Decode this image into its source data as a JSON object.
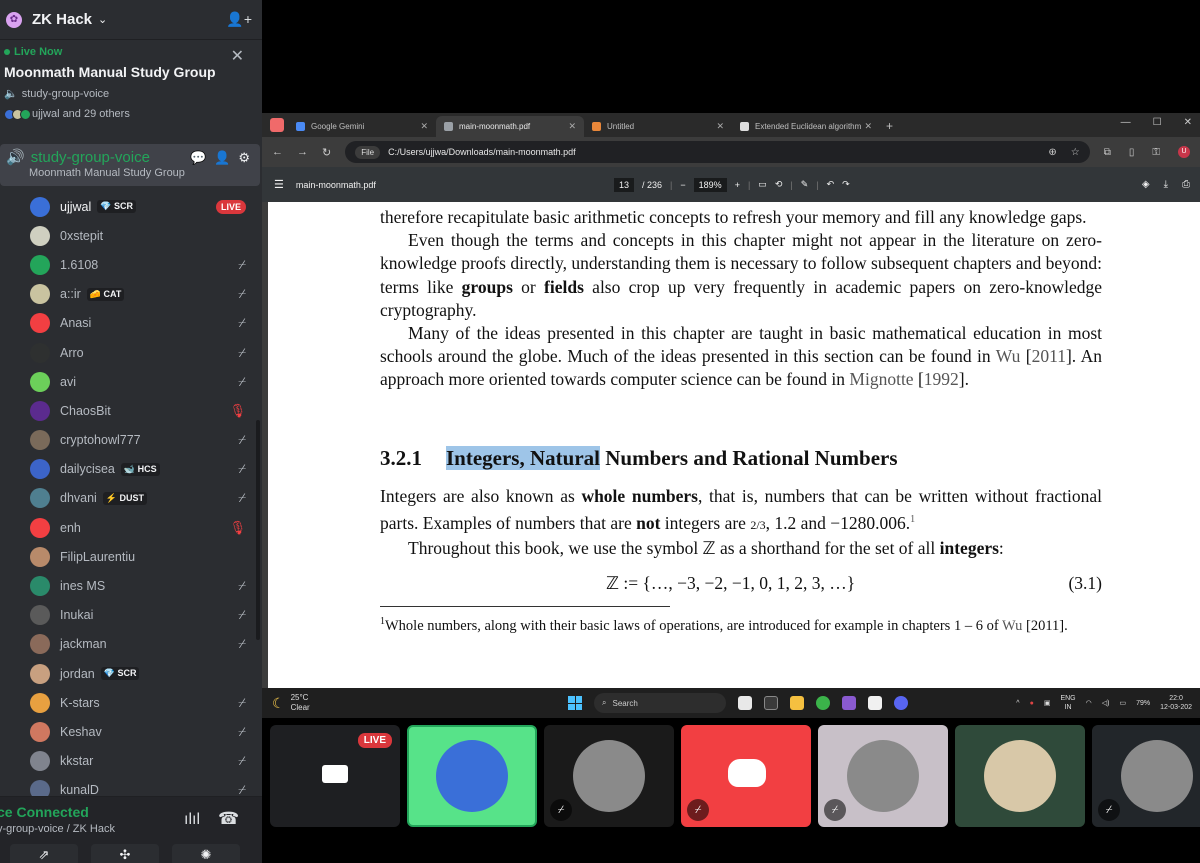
{
  "server": {
    "name": "ZK Hack"
  },
  "event": {
    "live_label": "Live Now",
    "title": "Moonmath Manual Study Group",
    "channel": "study-group-voice",
    "attendees": "ujjwal and 29 others"
  },
  "voice_channel": {
    "name": "study-group-voice",
    "subtitle": "Moonmath Manual Study Group"
  },
  "members": [
    {
      "name": "ujjwal",
      "tag": "SCR",
      "tag_icon": "💎",
      "status": "live",
      "color": "#3a6fd8"
    },
    {
      "name": "0xstepit",
      "tag": "",
      "status": "",
      "color": "#cfcfc0"
    },
    {
      "name": "1.6108",
      "tag": "",
      "status": "muted",
      "color": "#23a55a"
    },
    {
      "name": "a::ir",
      "tag": "CAT",
      "tag_icon": "🧀",
      "status": "muted",
      "color": "#c9c3a0"
    },
    {
      "name": "Anasi",
      "tag": "",
      "status": "muted",
      "color": "#f23f42"
    },
    {
      "name": "Arro",
      "tag": "",
      "status": "muted",
      "color": "#2e3030"
    },
    {
      "name": "avi",
      "tag": "",
      "status": "muted",
      "color": "#6ccf5a"
    },
    {
      "name": "ChaosBit",
      "tag": "",
      "status": "speaking",
      "color": "#5b2b8e"
    },
    {
      "name": "cryptohowl777",
      "tag": "",
      "status": "muted",
      "color": "#7a6a5a"
    },
    {
      "name": "dailycisea",
      "tag": "HCS",
      "tag_icon": "🐋",
      "status": "muted",
      "color": "#3c64c8"
    },
    {
      "name": "dhvani",
      "tag": "DUST",
      "tag_icon": "⚡",
      "status": "muted",
      "color": "#4f7f90"
    },
    {
      "name": "enh",
      "tag": "",
      "status": "speaking",
      "color": "#f23f42"
    },
    {
      "name": "FilipLaurentiu",
      "tag": "",
      "status": "",
      "color": "#b88a6a"
    },
    {
      "name": "ines MS",
      "tag": "",
      "status": "muted",
      "color": "#2a8a6a"
    },
    {
      "name": "Inukai",
      "tag": "",
      "status": "muted",
      "color": "#5a5a5a"
    },
    {
      "name": "jackman",
      "tag": "",
      "status": "muted",
      "color": "#8a6a5a"
    },
    {
      "name": "jordan",
      "tag": "SCR",
      "tag_icon": "💎",
      "status": "",
      "color": "#c8a080"
    },
    {
      "name": "K-stars",
      "tag": "",
      "status": "muted",
      "color": "#e8a040"
    },
    {
      "name": "Keshav",
      "tag": "",
      "status": "muted",
      "color": "#d07860"
    },
    {
      "name": "kkstar",
      "tag": "",
      "status": "muted",
      "color": "#80848e"
    },
    {
      "name": "kunalD",
      "tag": "",
      "status": "muted",
      "color": "#5a6a8a"
    }
  ],
  "voice_connected": {
    "title": "ce Connected",
    "subtitle": "y-group-voice / ZK Hack"
  },
  "browser": {
    "tabs": [
      {
        "label": "Google Gemini",
        "color": "#4a8af4",
        "active": false
      },
      {
        "label": "main-moonmath.pdf",
        "color": "#9aa0a6",
        "active": true
      },
      {
        "label": "Untitled",
        "color": "#e8873a",
        "active": false
      },
      {
        "label": "Extended Euclidean algorithm",
        "color": "#dddddd",
        "active": false
      }
    ],
    "url_chip": "File",
    "url": "C:/Users/ujjwa/Downloads/main-moonmath.pdf",
    "profile_letter": "U"
  },
  "pdf": {
    "filename": "main-moonmath.pdf",
    "page_current": "13",
    "page_total": "/ 236",
    "zoom": "189%"
  },
  "document": {
    "line0": "therefore recapitulate basic arithmetic concepts to refresh your memory and fill any knowledge gaps.",
    "p1_a": "Even though the terms and concepts in this chapter might not appear in the literature on zero-knowledge proofs directly, understanding them is necessary to follow subsequent chapters and beyond: terms like ",
    "p1_b": "groups",
    "p1_c": " or ",
    "p1_d": "fields",
    "p1_e": " also crop up very frequently in academic papers on zero-knowledge cryptography.",
    "p2_a": "Many of the ideas presented in this chapter are taught in basic mathematical education in most schools around the globe. Much of the ideas presented in this section can be found in ",
    "p2_cite1": "Wu",
    "p2_b": " [",
    "p2_cite1y": "2011",
    "p2_c": "]. An approach more oriented towards computer science can be found in ",
    "p2_cite2": "Mignotte",
    "p2_d": " [",
    "p2_cite2y": "1992",
    "p2_e": "].",
    "section_num": "3.2.1",
    "section_hl": "Integers, Natural",
    "section_rest": " Numbers and Rational Numbers",
    "p3_a": "Integers are also known as ",
    "p3_b": "whole numbers",
    "p3_c": ", that is, numbers that can be written without fractional parts. Examples of numbers that are ",
    "p3_d": "not",
    "p3_e": " integers are ",
    "p3_frac": "2/3",
    "p3_f": ", 1.2 and −1280.006.",
    "p3_fn": "1",
    "p4_a": "Throughout this book, we use the symbol ℤ as a shorthand for the set of all ",
    "p4_b": "integers",
    "p4_c": ":",
    "equation": "ℤ := {…, −3, −2, −1, 0, 1, 2, 3, …}",
    "equation_no": "(3.1)",
    "footnote_num": "1",
    "footnote_a": "Whole numbers, along with their basic laws of operations, are introduced for example in chapters 1 – 6 of ",
    "footnote_cite": "Wu",
    "footnote_b": " [2011]."
  },
  "taskbar": {
    "temp": "25°C",
    "weather": "Clear",
    "search": "Search",
    "lang": "ENG",
    "region": "IN",
    "battery": "79%",
    "time": "22:0",
    "date": "12-03-202"
  },
  "tiles": [
    {
      "kind": "stream",
      "live": "LIVE",
      "bg": "#1e1f22"
    },
    {
      "kind": "avatar",
      "bg": "#57e389",
      "muted": false
    },
    {
      "kind": "avatar",
      "bg": "#1a1a1a",
      "muted": true
    },
    {
      "kind": "discord",
      "bg": "#f23f42",
      "muted": true
    },
    {
      "kind": "avatar",
      "bg": "#c8c0c8",
      "muted": true
    },
    {
      "kind": "avatar",
      "bg": "#2f4a3a",
      "muted": false
    },
    {
      "kind": "avatar",
      "bg": "#22262a",
      "muted": true
    }
  ]
}
